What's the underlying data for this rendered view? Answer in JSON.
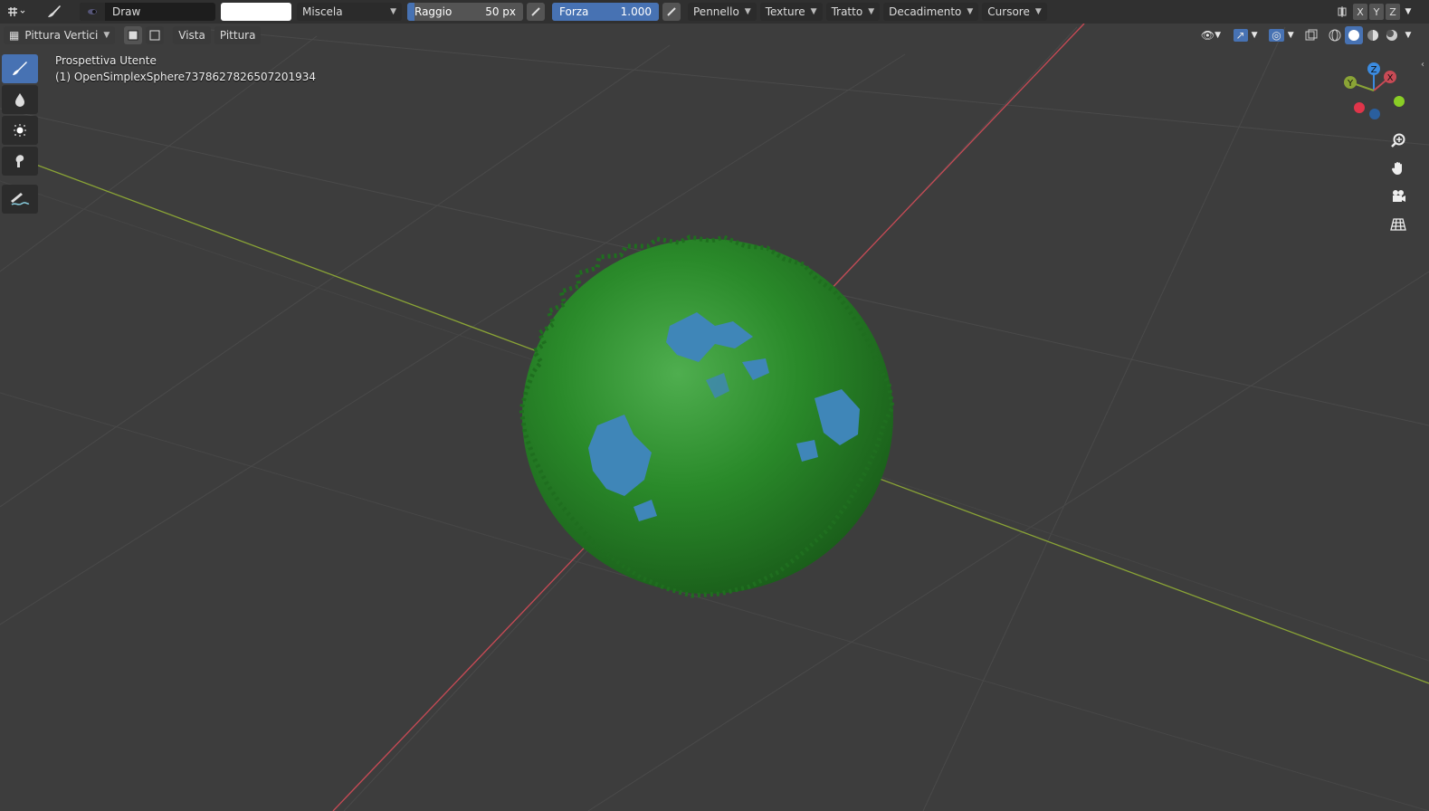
{
  "toolbar": {
    "tool_name": "Draw",
    "blend_mode": "Miscela",
    "radius_label": "Raggio",
    "radius_value": "50 px",
    "strength_label": "Forza",
    "strength_value": "1.000",
    "strength_fraction": 1.0,
    "menus": [
      "Pennello",
      "Texture",
      "Tratto",
      "Decadimento",
      "Cursore"
    ],
    "axes": [
      "X",
      "Y",
      "Z"
    ],
    "brush_color": "#ffffff",
    "accent": "#4772b3"
  },
  "header": {
    "mode": "Pittura Vertici",
    "menus": [
      "Vista",
      "Pittura"
    ]
  },
  "viewport": {
    "view_name": "Prospettiva Utente",
    "object_name": "(1) OpenSimplexSphere7378627826507201934",
    "gizmo": {
      "x_label": "X",
      "y_label": "Y",
      "z_label": "Z"
    },
    "colors": {
      "background": "#3d3d3d",
      "x_axis": "#c84a55",
      "y_axis": "#8aa436",
      "sphere": "#2a8a2a",
      "sphere_patch": "#3f86b8"
    }
  },
  "left_tools": [
    "brush-icon",
    "blur-icon",
    "average-icon",
    "smear-icon",
    "annotate-icon"
  ],
  "right_nav": [
    "zoom-icon",
    "pan-icon",
    "camera-icon",
    "grid-icon"
  ]
}
